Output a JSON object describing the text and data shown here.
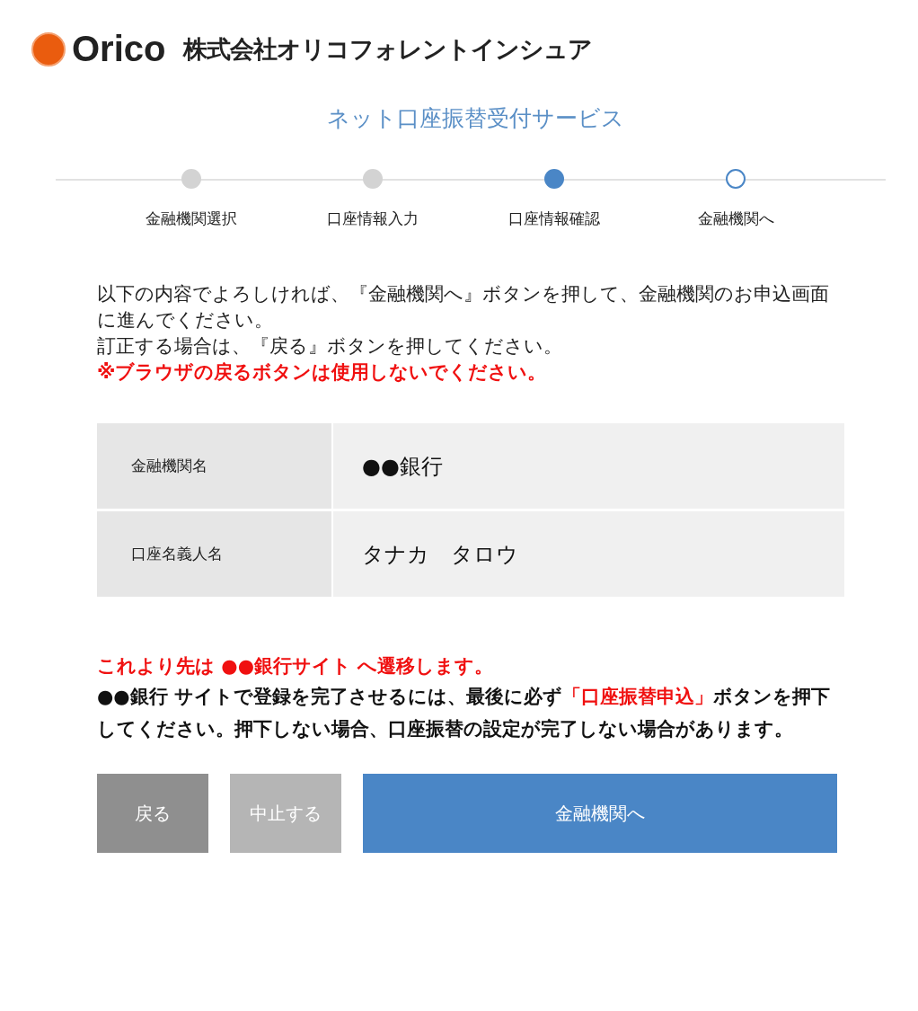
{
  "header": {
    "logo_text": "Orico",
    "company": "株式会社オリコフォレントインシュア"
  },
  "title": "ネット口座振替受付サービス",
  "steps": [
    {
      "label": "金融機関選択",
      "kind": "done"
    },
    {
      "label": "口座情報入力",
      "kind": "done"
    },
    {
      "label": "口座情報確認",
      "kind": "current"
    },
    {
      "label": "金融機関へ",
      "kind": "next"
    }
  ],
  "instructions": [
    "以下の内容でよろしければ、『金融機関へ』ボタンを押して、金融機関のお申込画面に進んでください。",
    "訂正する場合は、『戻る』ボタンを押してください。"
  ],
  "warning": "※ブラウザの戻るボタンは使用しないでください。",
  "details": [
    {
      "label": "金融機関名",
      "value": "●●銀行"
    },
    {
      "label": "口座名義人名",
      "value": "タナカ　タロウ"
    }
  ],
  "notice_heading": "これより先は ●●銀行サイト へ遷移します。",
  "notice": [
    {
      "text": "●●銀行 サイトで登録を完了させるには、最後に必ず",
      "emphasis": false
    },
    {
      "text": "「口座振替申込」",
      "emphasis": true
    },
    {
      "text": "ボタンを押下してください。押下しない場合、口座振替の設定が完了しない場合があります。",
      "emphasis": false
    }
  ],
  "buttons": [
    {
      "label": "戻る",
      "kind": "back"
    },
    {
      "label": "中止する",
      "kind": "cancel"
    },
    {
      "label": "金融機関へ",
      "kind": "primary"
    }
  ]
}
